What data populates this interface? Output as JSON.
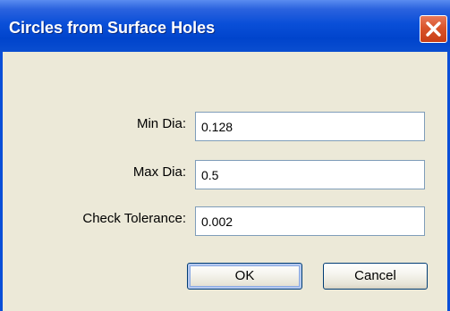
{
  "window": {
    "title": "Circles from Surface Holes"
  },
  "form": {
    "min_dia": {
      "label": "Min Dia:",
      "value": "0.128"
    },
    "max_dia": {
      "label": "Max Dia:",
      "value": "0.5"
    },
    "check_tolerance": {
      "label": "Check Tolerance:",
      "value": "0.002"
    }
  },
  "buttons": {
    "ok": "OK",
    "cancel": "Cancel"
  },
  "icons": {
    "close": "close-icon"
  },
  "colors": {
    "titlebar": "#0a4fd8",
    "close_button": "#d9542b",
    "client_bg": "#ece9d8"
  }
}
